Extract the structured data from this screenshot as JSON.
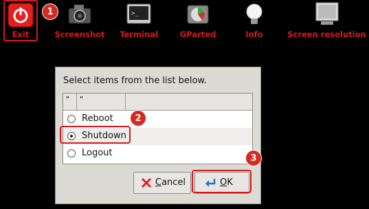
{
  "toolbar": {
    "items": [
      {
        "label": "Exit",
        "icon": "power-icon"
      },
      {
        "label": "Screenshot",
        "icon": "camera-icon"
      },
      {
        "label": "Terminal",
        "icon": "terminal-icon"
      },
      {
        "label": "GParted",
        "icon": "gparted-icon"
      },
      {
        "label": "Info",
        "icon": "lightbulb-icon"
      },
      {
        "label": "Screen resolution",
        "icon": "monitor-icon"
      }
    ]
  },
  "badges": {
    "one": "1",
    "two": "2",
    "three": "3"
  },
  "dialog": {
    "message": "Select items from the list below.",
    "columns": [
      "\"",
      "\""
    ],
    "options": [
      {
        "label": "Reboot",
        "selected": false
      },
      {
        "label": "Shutdown",
        "selected": true
      },
      {
        "label": "Logout",
        "selected": false
      }
    ],
    "cancel_label": "Cancel",
    "ok_label": "OK"
  },
  "colors": {
    "accent": "#d61a1a",
    "dialog_bg": "#dcdad5"
  }
}
